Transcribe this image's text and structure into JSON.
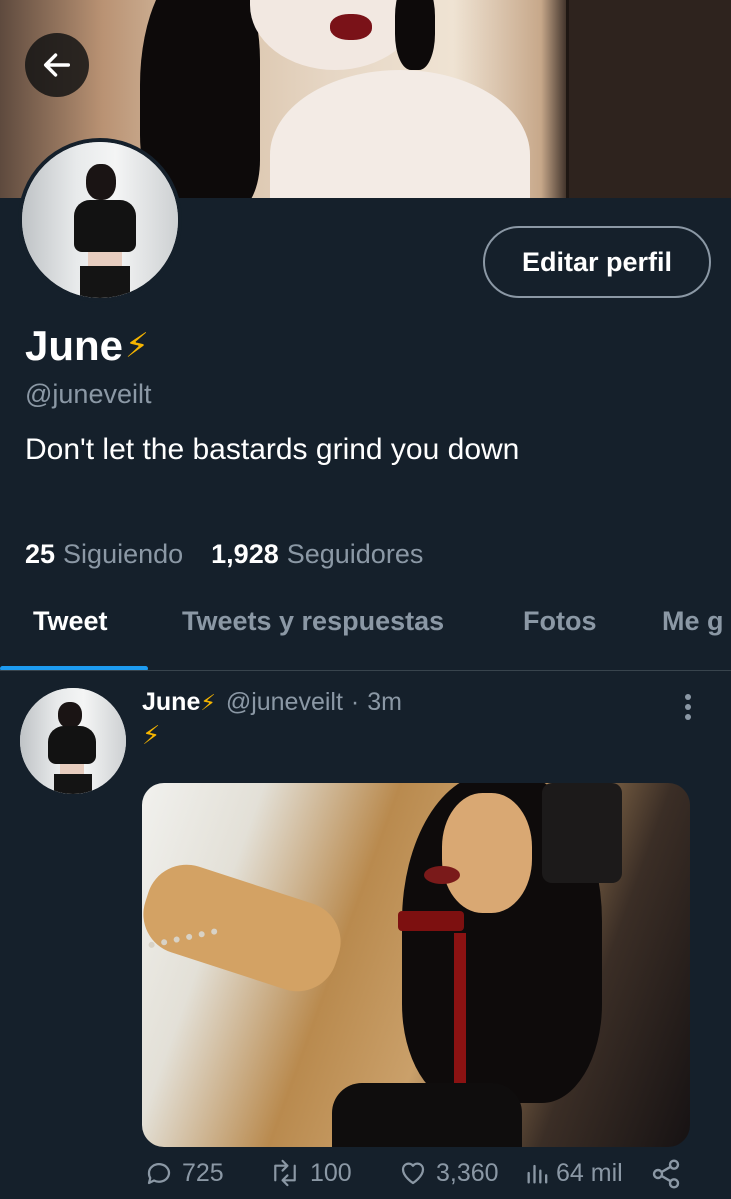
{
  "profile": {
    "display_name": "June",
    "name_emoji": "⚡",
    "handle": "@juneveilt",
    "bio": "Don't let the bastards grind you down",
    "edit_button_label": "Editar perfil",
    "following_count": "25",
    "following_label": "Siguiendo",
    "followers_count": "1,928",
    "followers_label": "Seguidores"
  },
  "tabs": [
    {
      "label": "Tweet",
      "active": true
    },
    {
      "label": "Tweets y respuestas",
      "active": false
    },
    {
      "label": "Fotos",
      "active": false
    },
    {
      "label": "Me g",
      "active": false
    }
  ],
  "tweet": {
    "author_name": "June",
    "author_emoji": "⚡",
    "author_handle": "@juneveilt",
    "separator": "·",
    "time": "3m",
    "text": "⚡",
    "replies": "725",
    "retweets": "100",
    "likes": "3,360",
    "views": "64 mil"
  },
  "colors": {
    "background": "#15202b",
    "secondary_text": "#8b98a5",
    "accent": "#1d9bf0",
    "divider": "#38444d"
  },
  "icons": {
    "back": "arrow-left-icon",
    "more": "more-vertical-icon",
    "reply": "reply-icon",
    "retweet": "retweet-icon",
    "like": "heart-icon",
    "views": "views-icon",
    "share": "share-icon"
  }
}
